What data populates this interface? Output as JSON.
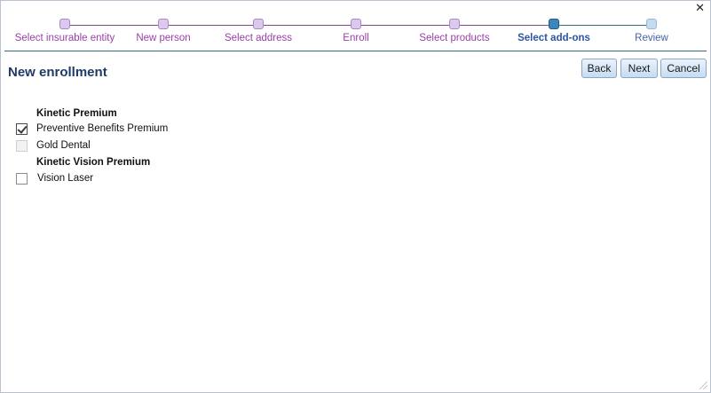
{
  "window": {
    "close_icon": "close-icon"
  },
  "wizard": {
    "steps": [
      {
        "label": "Select insurable entity",
        "state": "done"
      },
      {
        "label": "New person",
        "state": "done"
      },
      {
        "label": "Select address",
        "state": "done"
      },
      {
        "label": "Enroll",
        "state": "done"
      },
      {
        "label": "Select products",
        "state": "done"
      },
      {
        "label": "Select add-ons",
        "state": "current"
      },
      {
        "label": "Review",
        "state": "todo"
      }
    ],
    "colors": {
      "done": "#9a3fa8",
      "current": "#2c55a3",
      "todo": "#4a5fa8",
      "divider": "#2e6e77"
    }
  },
  "page": {
    "title": "New enrollment"
  },
  "buttons": {
    "back": "Back",
    "next": "Next",
    "cancel": "Cancel"
  },
  "groups": [
    {
      "title": "Kinetic Premium",
      "options": [
        {
          "label": "Preventive Benefits Premium",
          "checked": true,
          "disabled": false
        },
        {
          "label": "Gold Dental",
          "checked": false,
          "disabled": true
        }
      ]
    },
    {
      "title": "Kinetic Vision Premium",
      "options": [
        {
          "label": "Vision Laser",
          "checked": false,
          "disabled": false
        }
      ]
    }
  ]
}
